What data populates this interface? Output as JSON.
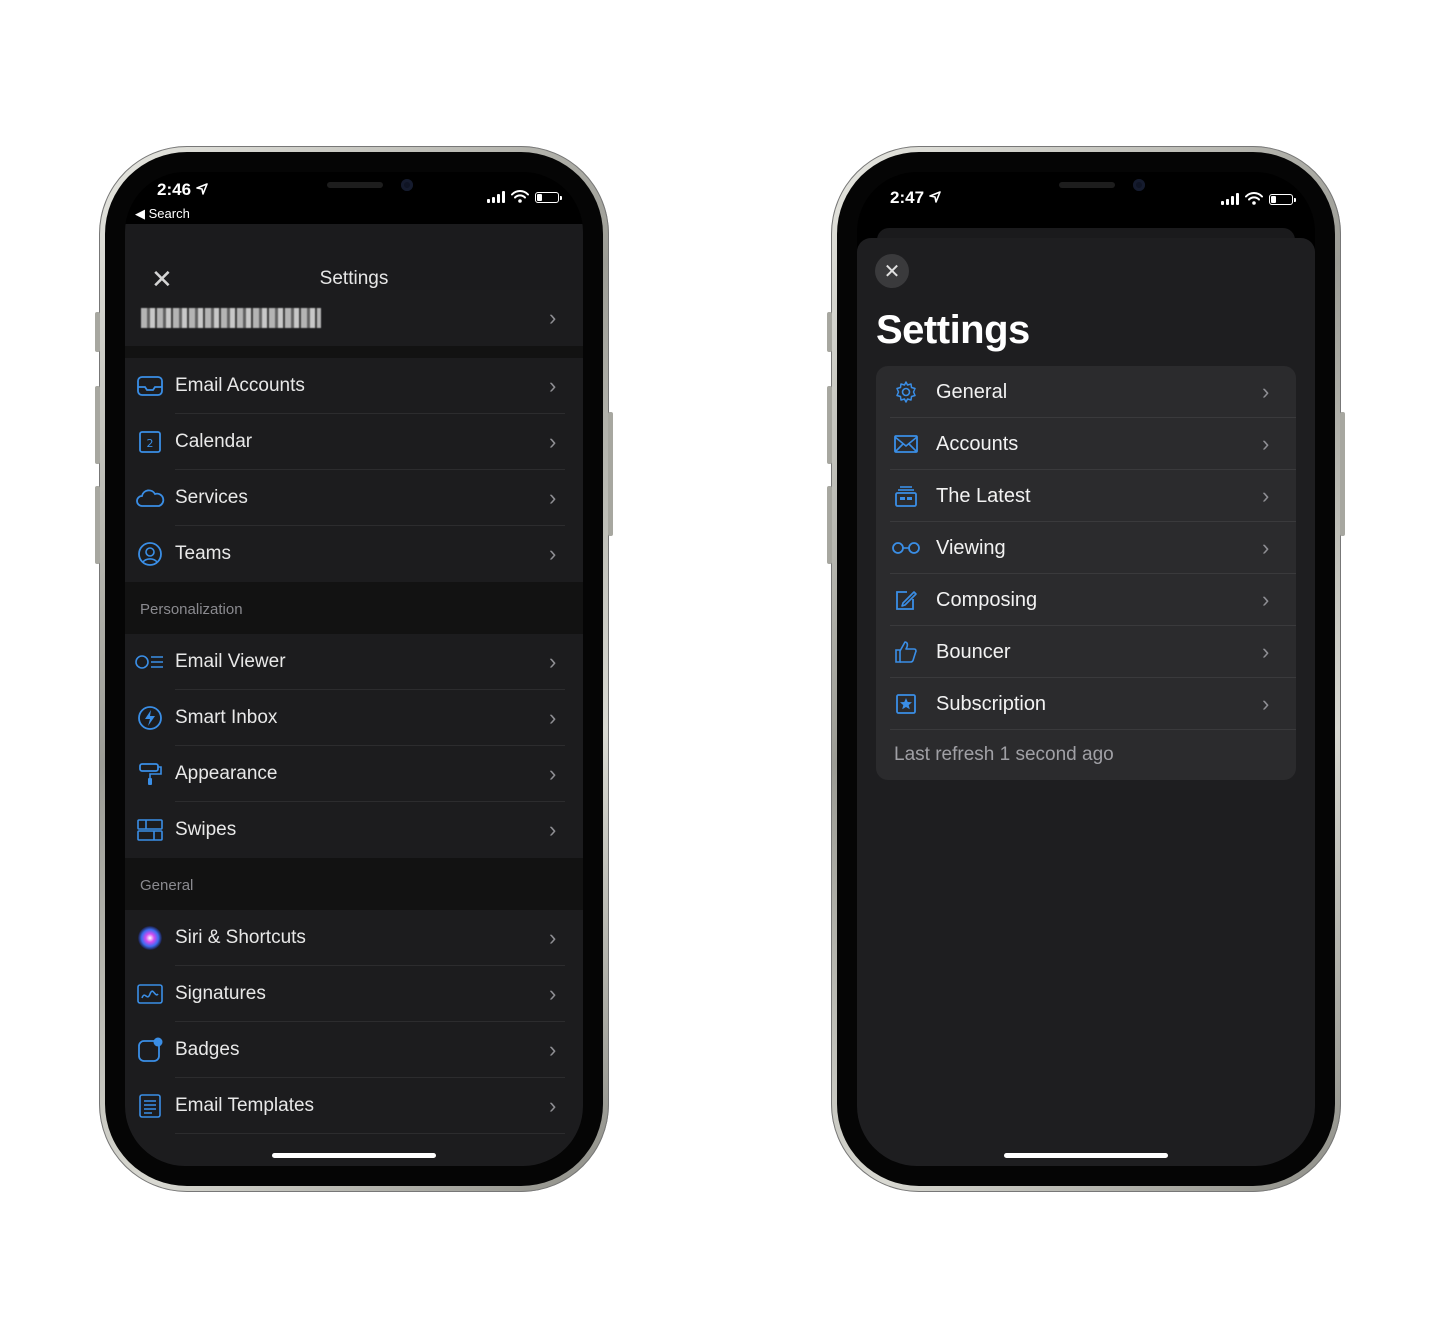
{
  "left_phone": {
    "status": {
      "time": "2:46",
      "back_label": "Search"
    },
    "nav": {
      "title": "Settings"
    },
    "account_row": {
      "chevron": "›"
    },
    "main_items": [
      {
        "label": "Email Accounts",
        "icon": "inbox-icon"
      },
      {
        "label": "Calendar",
        "icon": "calendar-icon"
      },
      {
        "label": "Services",
        "icon": "cloud-icon"
      },
      {
        "label": "Teams",
        "icon": "person-circle-icon"
      }
    ],
    "personalization": {
      "header": "Personalization",
      "items": [
        {
          "label": "Email Viewer",
          "icon": "viewer-icon"
        },
        {
          "label": "Smart Inbox",
          "icon": "bolt-icon"
        },
        {
          "label": "Appearance",
          "icon": "paint-roller-icon"
        },
        {
          "label": "Swipes",
          "icon": "swipes-icon"
        }
      ]
    },
    "general": {
      "header": "General",
      "items": [
        {
          "label": "Siri & Shortcuts",
          "icon": "siri-icon"
        },
        {
          "label": "Signatures",
          "icon": "signature-icon"
        },
        {
          "label": "Badges",
          "icon": "badge-icon"
        },
        {
          "label": "Email Templates",
          "icon": "template-icon"
        }
      ]
    }
  },
  "right_phone": {
    "status": {
      "time": "2:47"
    },
    "title": "Settings",
    "items": [
      {
        "label": "General",
        "icon": "gear-icon"
      },
      {
        "label": "Accounts",
        "icon": "envelope-icon"
      },
      {
        "label": "The Latest",
        "icon": "tray-icon"
      },
      {
        "label": "Viewing",
        "icon": "glasses-icon"
      },
      {
        "label": "Composing",
        "icon": "compose-icon"
      },
      {
        "label": "Bouncer",
        "icon": "thumbs-up-icon"
      },
      {
        "label": "Subscription",
        "icon": "star-square-icon"
      }
    ],
    "footer": "Last refresh 1 second ago"
  },
  "colors": {
    "accent": "#3a8ee6",
    "row_bg": "#1c1c1e",
    "card_bg": "#2b2b2d"
  }
}
